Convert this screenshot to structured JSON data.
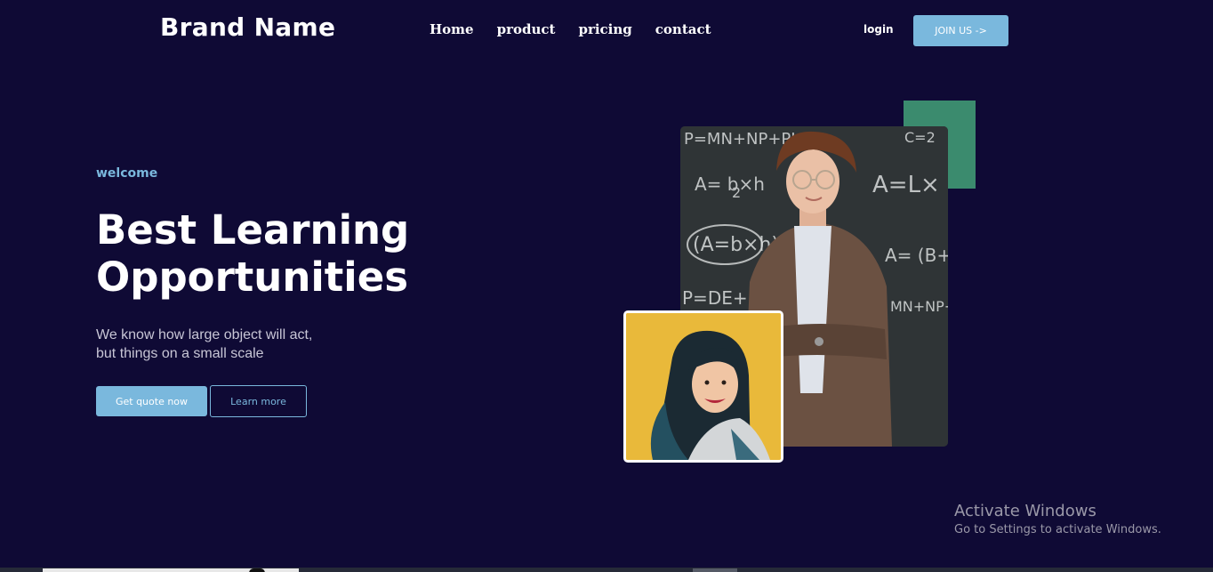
{
  "brand": {
    "name": "Brand Name"
  },
  "nav": {
    "items": [
      {
        "label": "Home"
      },
      {
        "label": "product"
      },
      {
        "label": "pricing"
      },
      {
        "label": "contact"
      }
    ],
    "login_label": "login",
    "join_label": "JOIN US ->"
  },
  "hero": {
    "eyebrow": "welcome",
    "title_line1": "Best Learning",
    "title_line2": "Opportunities",
    "subtitle_line1": "We know how large object will act,",
    "subtitle_line2": "but things on a small scale",
    "primary_button": "Get quote now",
    "secondary_button": "Learn more"
  },
  "chalkboard": {
    "lines": [
      "P=MN+NP+PI",
      "C=2",
      "A= b×h",
      "2",
      "A=L×",
      "(A=b×h)",
      "A= (B+",
      "P=DE+",
      "MN+NP+"
    ]
  },
  "watermark": {
    "title": "Activate Windows",
    "subtitle": "Go to Settings to activate Windows."
  },
  "colors": {
    "background": "#0f0a35",
    "accent": "#7ab8dd",
    "green_block": "#3b8b6e",
    "student_bg": "#e8b935"
  }
}
